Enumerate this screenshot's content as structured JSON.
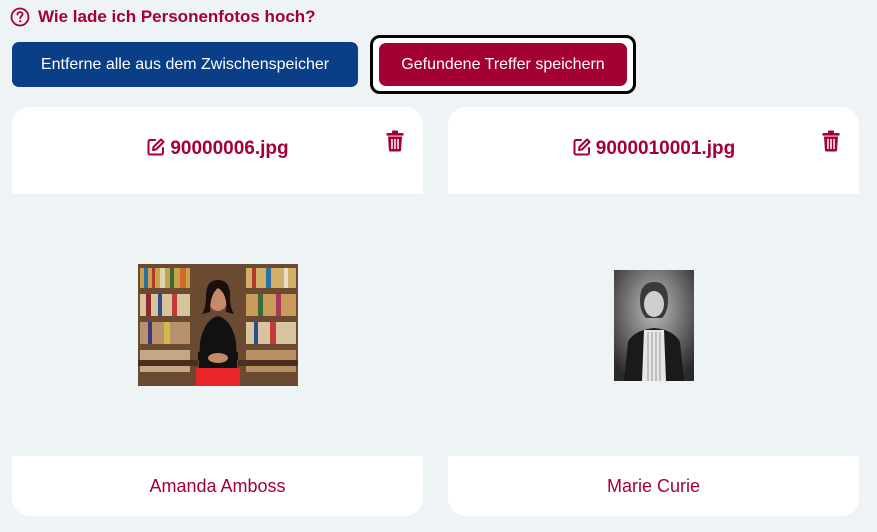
{
  "help": {
    "label": "Wie lade ich Personenfotos hoch?"
  },
  "toolbar": {
    "clear_label": "Entferne alle aus dem Zwischenspeicher",
    "save_label": "Gefundene Treffer speichern"
  },
  "cards": [
    {
      "filename": "90000006.jpg",
      "name": "Amanda Amboss"
    },
    {
      "filename": "9000010001.jpg",
      "name": "Marie Curie"
    }
  ],
  "colors": {
    "accent": "#a50034",
    "primary": "#0a3f88",
    "background": "#eef3f6"
  }
}
